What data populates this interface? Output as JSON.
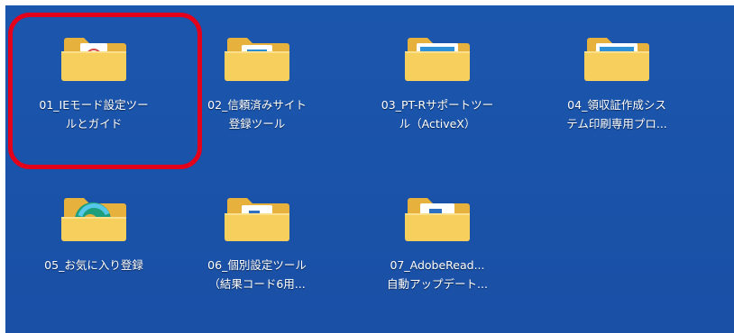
{
  "desktop": {
    "background_color": "#1a52a8",
    "icons": [
      {
        "line1": "01_IEモード設定ツー",
        "line2": "ルとガイド",
        "icon": "folder-document-icon"
      },
      {
        "line1": "02_信頼済みサイト",
        "line2": "登録ツール",
        "icon": "folder-icon"
      },
      {
        "line1": "03_PT-Rサポートツー",
        "line2": "ル（ActiveX）",
        "icon": "folder-icon"
      },
      {
        "line1": "04_領収証作成シス",
        "line2": "テム印刷専用プロ...",
        "icon": "folder-icon"
      },
      {
        "line1": "05_お気に入り登録",
        "line2": "",
        "icon": "folder-edge-icon"
      },
      {
        "line1": "06_個別設定ツール",
        "line2": "（結果コード6用...",
        "icon": "folder-icon"
      },
      {
        "line1": "07_AdobeRead...",
        "line2": "自動アップデート...",
        "icon": "folder-icon"
      }
    ]
  },
  "highlight": {
    "color": "#e3001b",
    "target": "01_IEモード設定ツールとガイド"
  }
}
